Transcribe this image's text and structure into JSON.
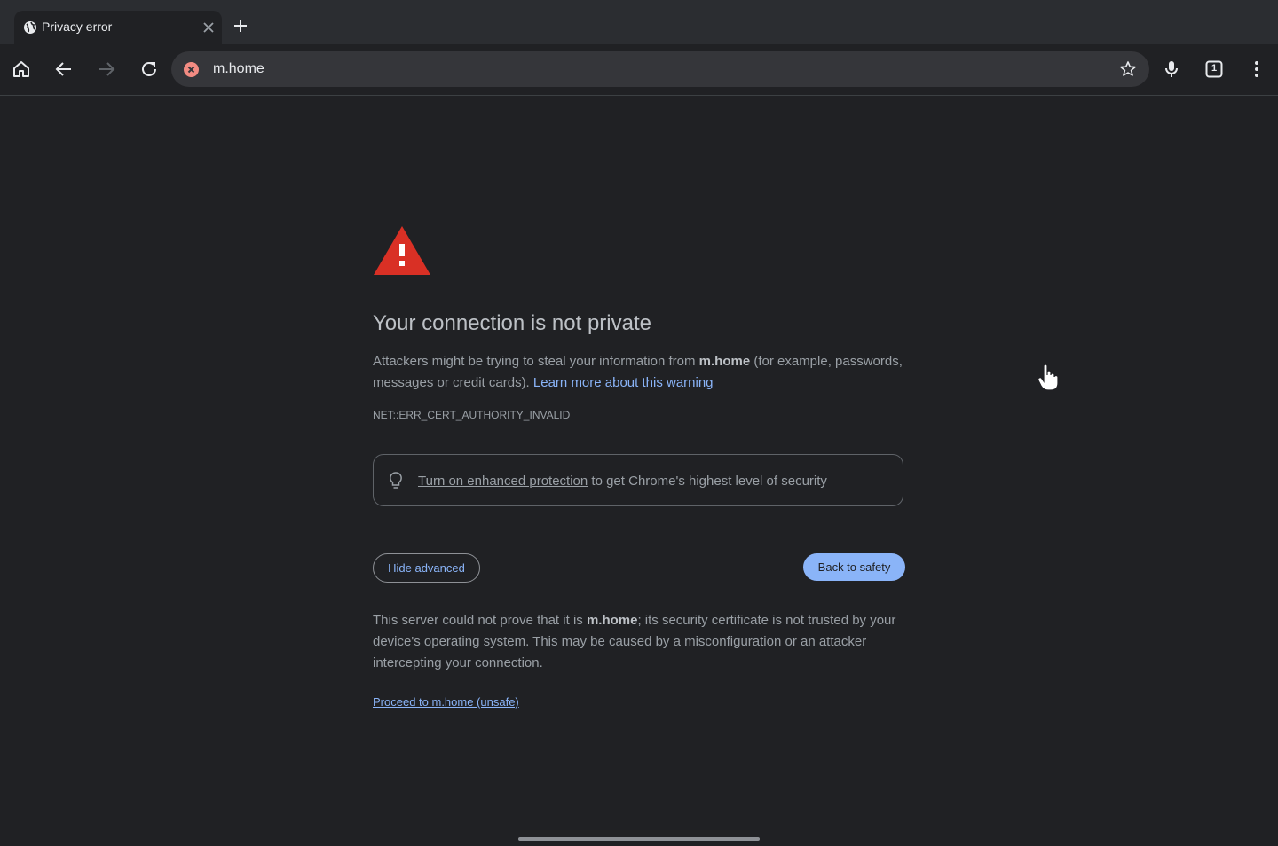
{
  "tab": {
    "title": "Privacy error"
  },
  "omnibox": {
    "url": "m.home"
  },
  "toolbar": {
    "tab_count": "1"
  },
  "page": {
    "title": "Your connection is not private",
    "desc_part1": "Attackers might be trying to steal your information from ",
    "desc_host": "m.home",
    "desc_part2": " (for example, passwords, messages or credit cards). ",
    "learn_more": "Learn more about this warning",
    "error_code": "NET::ERR_CERT_AUTHORITY_INVALID",
    "promo_link": "Turn on enhanced protection",
    "promo_rest": " to get Chrome's highest level of security",
    "hide_advanced": "Hide advanced",
    "back_to_safety": "Back to safety",
    "details_part1": "This server could not prove that it is ",
    "details_host": "m.home",
    "details_part2": "; its security certificate is not trusted by your device's operating system. This may be caused by a misconfiguration or an attacker intercepting your connection.",
    "proceed": "Proceed to m.home (unsafe)"
  },
  "colors": {
    "accent": "#8ab4f8",
    "warning": "#d93025",
    "background": "#202124"
  }
}
